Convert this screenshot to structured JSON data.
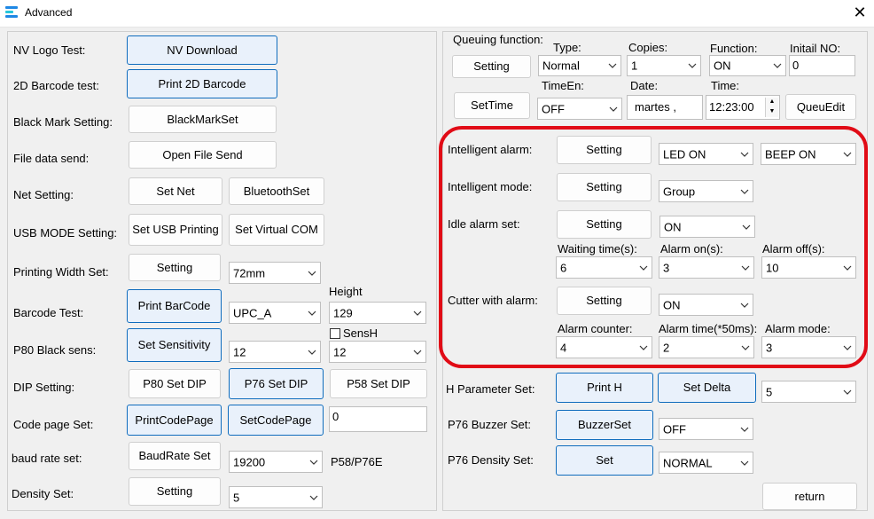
{
  "window": {
    "title": "Advanced",
    "close_glyph": "✕"
  },
  "left": {
    "nv_logo_label": "NV Logo Test:",
    "nv_download": "NV Download",
    "barcode2d_label": "2D Barcode test:",
    "print_2d": "Print 2D Barcode",
    "black_mark_label": "Black Mark Setting:",
    "black_mark_set": "BlackMarkSet",
    "file_send_label": "File data send:",
    "open_file_send": "Open File Send",
    "net_label": "Net Setting:",
    "set_net": "Set Net",
    "bluetooth_set": "BluetoothSet",
    "usb_label": "USB MODE Setting:",
    "set_usb_printing": "Set USB Printing",
    "set_virtual_com": "Set Virtual COM",
    "width_label": "Printing Width Set:",
    "width_setting": "Setting",
    "width_value": "72mm",
    "height_label": "Height",
    "barcode_label": "Barcode Test:",
    "print_barcode": "Print BarCode",
    "barcode_type": "UPC_A",
    "barcode_height": "129",
    "sensh_label": "SensH",
    "black_sens_label": "P80 Black sens:",
    "set_sensitivity": "Set Sensitivity",
    "sens_value": "12",
    "sensh_value": "12",
    "dip_label": "DIP Setting:",
    "p80_set_dip": "P80 Set DIP",
    "p76_set_dip": "P76 Set DIP",
    "p58_set_dip": "P58 Set DIP",
    "codepage_label": "Code page Set:",
    "print_codepage": "PrintCodePage",
    "set_codepage": "SetCodePage",
    "codepage_value": "0",
    "baud_label": "baud rate set:",
    "baud_rate_set": "BaudRate Set",
    "baud_value": "19200",
    "baud_note": "P58/P76E",
    "density_label": "Density Set:",
    "density_setting": "Setting",
    "density_value": "5"
  },
  "queue": {
    "function_label": "Queuing function:",
    "type_label": "Type:",
    "copies_label": "Copies:",
    "function2_label": "Function:",
    "initial_no_label": "Initail NO:",
    "setting": "Setting",
    "type_value": "Normal",
    "copies_value": "1",
    "function_value": "ON",
    "initial_no_value": "0",
    "timeen_label": "TimeEn:",
    "date_label": "Date:",
    "time_label": "Time:",
    "settime": "SetTime",
    "timeen_value": "OFF",
    "date_value": "martes   ,",
    "time_value": "12:23:00",
    "queuedit": "QueuEdit"
  },
  "alarm": {
    "intelligent_alarm_label": "Intelligent alarm:",
    "intelligent_alarm_setting": "Setting",
    "led_value": "LED ON",
    "beep_value": "BEEP ON",
    "intelligent_mode_label": "Intelligent mode:",
    "intelligent_mode_setting": "Setting",
    "mode_value": "Group",
    "idle_alarm_label": "Idle alarm set:",
    "idle_alarm_setting": "Setting",
    "idle_value": "ON",
    "waiting_time_label": "Waiting time(s):",
    "alarm_on_label": "Alarm on(s):",
    "alarm_off_label": "Alarm off(s):",
    "waiting_time_value": "6",
    "alarm_on_value": "3",
    "alarm_off_value": "10",
    "cutter_alarm_label": "Cutter with alarm:",
    "cutter_alarm_setting": "Setting",
    "cutter_value": "ON",
    "alarm_counter_label": "Alarm counter:",
    "alarm_time_label": "Alarm time(*50ms):",
    "alarm_mode_label": "Alarm mode:",
    "alarm_counter_value": "4",
    "alarm_time_value": "2",
    "alarm_mode_value": "3"
  },
  "lower": {
    "h_param_label": "H Parameter Set:",
    "print_h": "Print H",
    "set_delta": "Set Delta",
    "h_value": "5",
    "buzzer_label": "P76 Buzzer Set:",
    "buzzer_set": "BuzzerSet",
    "buzzer_value": "OFF",
    "density76_label": "P76 Density Set:",
    "density76_set": "Set",
    "density76_value": "NORMAL",
    "return": "return"
  },
  "colors": {
    "highlight_ring": "#e10b16",
    "accent_border": "#0f6cbd"
  }
}
